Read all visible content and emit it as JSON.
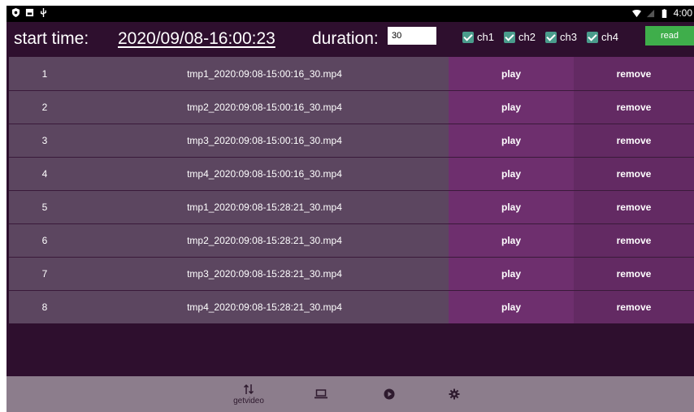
{
  "status_bar": {
    "time": "4:00"
  },
  "header": {
    "start_label": "start time:",
    "start_value": "2020/09/08-16:00:23",
    "duration_label": "duration:",
    "duration_value": "30",
    "channels": [
      {
        "label": "ch1",
        "checked": true
      },
      {
        "label": "ch2",
        "checked": true
      },
      {
        "label": "ch3",
        "checked": true
      },
      {
        "label": "ch4",
        "checked": true
      }
    ],
    "read_label": "read"
  },
  "rows": [
    {
      "num": "1",
      "file": "tmp1_2020:09:08-15:00:16_30.mp4",
      "play": "play",
      "remove": "remove"
    },
    {
      "num": "2",
      "file": "tmp2_2020:09:08-15:00:16_30.mp4",
      "play": "play",
      "remove": "remove"
    },
    {
      "num": "3",
      "file": "tmp3_2020:09:08-15:00:16_30.mp4",
      "play": "play",
      "remove": "remove"
    },
    {
      "num": "4",
      "file": "tmp4_2020:09:08-15:00:16_30.mp4",
      "play": "play",
      "remove": "remove"
    },
    {
      "num": "5",
      "file": "tmp1_2020:09:08-15:28:21_30.mp4",
      "play": "play",
      "remove": "remove"
    },
    {
      "num": "6",
      "file": "tmp2_2020:09:08-15:28:21_30.mp4",
      "play": "play",
      "remove": "remove"
    },
    {
      "num": "7",
      "file": "tmp3_2020:09:08-15:28:21_30.mp4",
      "play": "play",
      "remove": "remove"
    },
    {
      "num": "8",
      "file": "tmp4_2020:09:08-15:28:21_30.mp4",
      "play": "play",
      "remove": "remove"
    }
  ],
  "bottom_nav": {
    "items": [
      {
        "icon": "getvideo-icon",
        "label": "getvideo"
      },
      {
        "icon": "laptop-icon",
        "label": ""
      },
      {
        "icon": "play-circle-icon",
        "label": ""
      },
      {
        "icon": "gear-icon",
        "label": ""
      }
    ]
  },
  "colors": {
    "background": "#2e0f2e",
    "row_main": "#5c4660",
    "play_cell": "#6e2f6e",
    "remove_cell": "#632a63",
    "read_button": "#3fae4b",
    "checkbox": "#4a9c8c",
    "bottom_nav": "#8c7d8c"
  }
}
